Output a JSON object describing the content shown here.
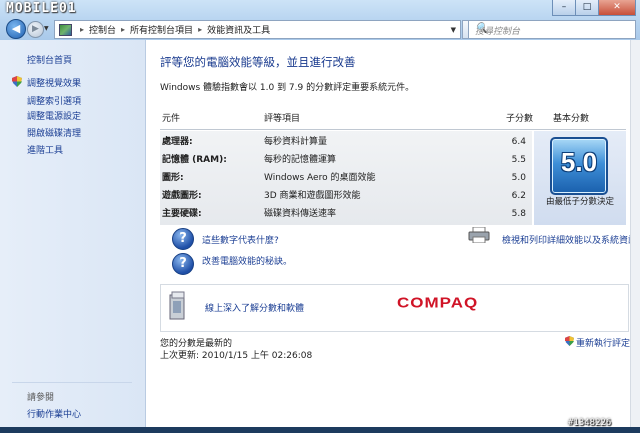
{
  "watermark": {
    "logo_text": "MOBILE01",
    "post_id": "#1348226"
  },
  "window": {
    "minimize": "–",
    "maximize": "□",
    "close": "✕"
  },
  "nav": {
    "back_glyph": "◀",
    "forward_glyph": "▶",
    "dropdown_glyph": "▼",
    "refresh_glyph": "↻",
    "breadcrumb": [
      "控制台",
      "所有控制台項目",
      "效能資訊及工具"
    ],
    "breadcrumb_sep": "▸",
    "search_placeholder": "搜尋控制台",
    "search_glyph": "🔍"
  },
  "sidebar": {
    "home": "控制台首頁",
    "items": [
      "調整視覺效果",
      "調整索引選項",
      "調整電源設定",
      "開啟磁碟清理",
      "進階工具"
    ],
    "see_also_heading": "請參閱",
    "see_also_items": [
      "行動作業中心"
    ]
  },
  "main": {
    "title": "評等您的電腦效能等級，並且進行改善",
    "description": "Windows 體驗指數會以 1.0 到 7.9 的分數評定重要系統元件。",
    "table": {
      "headers": {
        "component": "元件",
        "rating": "評等項目",
        "subscore": "子分數",
        "base": "基本分數"
      },
      "rows": [
        {
          "component": "處理器:",
          "rating": "每秒資料計算量",
          "subscore": "6.4"
        },
        {
          "component": "記憶體 (RAM):",
          "rating": "每秒的記憶體運算",
          "subscore": "5.5"
        },
        {
          "component": "圖形:",
          "rating": "Windows Aero 的桌面效能",
          "subscore": "5.0"
        },
        {
          "component": "遊戲圖形:",
          "rating": "3D 商業和遊戲圖形效能",
          "subscore": "6.2"
        },
        {
          "component": "主要硬碟:",
          "rating": "磁碟資料傳送速率",
          "subscore": "5.8"
        }
      ],
      "base_score": "5.0",
      "base_caption": "由最低子分數決定"
    },
    "links": {
      "what_numbers_mean": "這些數字代表什麼?",
      "improve_tips": "改善電腦效能的秘訣。",
      "print_details": "檢視和列印詳細效能以及系統資訊"
    },
    "panel": {
      "learn_more": "線上深入了解分數和軟體",
      "brand": "COMPAQ"
    },
    "status": "您的分數是最新的",
    "last_updated": "上次更新: 2010/1/15 上午 02:26:08",
    "rerun": "重新執行評定"
  }
}
